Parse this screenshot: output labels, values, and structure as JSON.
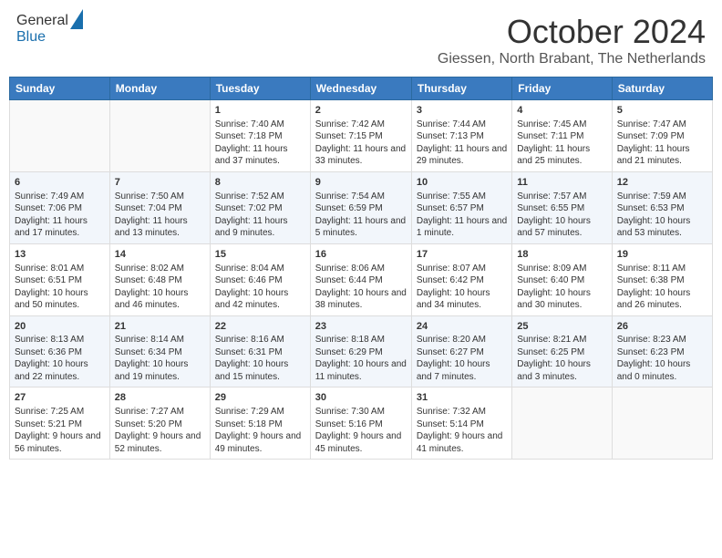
{
  "header": {
    "logo_line1": "General",
    "logo_line2": "Blue",
    "month": "October 2024",
    "location": "Giessen, North Brabant, The Netherlands"
  },
  "weekdays": [
    "Sunday",
    "Monday",
    "Tuesday",
    "Wednesday",
    "Thursday",
    "Friday",
    "Saturday"
  ],
  "weeks": [
    [
      {
        "day": "",
        "info": ""
      },
      {
        "day": "",
        "info": ""
      },
      {
        "day": "1",
        "info": "Sunrise: 7:40 AM\nSunset: 7:18 PM\nDaylight: 11 hours and 37 minutes."
      },
      {
        "day": "2",
        "info": "Sunrise: 7:42 AM\nSunset: 7:15 PM\nDaylight: 11 hours and 33 minutes."
      },
      {
        "day": "3",
        "info": "Sunrise: 7:44 AM\nSunset: 7:13 PM\nDaylight: 11 hours and 29 minutes."
      },
      {
        "day": "4",
        "info": "Sunrise: 7:45 AM\nSunset: 7:11 PM\nDaylight: 11 hours and 25 minutes."
      },
      {
        "day": "5",
        "info": "Sunrise: 7:47 AM\nSunset: 7:09 PM\nDaylight: 11 hours and 21 minutes."
      }
    ],
    [
      {
        "day": "6",
        "info": "Sunrise: 7:49 AM\nSunset: 7:06 PM\nDaylight: 11 hours and 17 minutes."
      },
      {
        "day": "7",
        "info": "Sunrise: 7:50 AM\nSunset: 7:04 PM\nDaylight: 11 hours and 13 minutes."
      },
      {
        "day": "8",
        "info": "Sunrise: 7:52 AM\nSunset: 7:02 PM\nDaylight: 11 hours and 9 minutes."
      },
      {
        "day": "9",
        "info": "Sunrise: 7:54 AM\nSunset: 6:59 PM\nDaylight: 11 hours and 5 minutes."
      },
      {
        "day": "10",
        "info": "Sunrise: 7:55 AM\nSunset: 6:57 PM\nDaylight: 11 hours and 1 minute."
      },
      {
        "day": "11",
        "info": "Sunrise: 7:57 AM\nSunset: 6:55 PM\nDaylight: 10 hours and 57 minutes."
      },
      {
        "day": "12",
        "info": "Sunrise: 7:59 AM\nSunset: 6:53 PM\nDaylight: 10 hours and 53 minutes."
      }
    ],
    [
      {
        "day": "13",
        "info": "Sunrise: 8:01 AM\nSunset: 6:51 PM\nDaylight: 10 hours and 50 minutes."
      },
      {
        "day": "14",
        "info": "Sunrise: 8:02 AM\nSunset: 6:48 PM\nDaylight: 10 hours and 46 minutes."
      },
      {
        "day": "15",
        "info": "Sunrise: 8:04 AM\nSunset: 6:46 PM\nDaylight: 10 hours and 42 minutes."
      },
      {
        "day": "16",
        "info": "Sunrise: 8:06 AM\nSunset: 6:44 PM\nDaylight: 10 hours and 38 minutes."
      },
      {
        "day": "17",
        "info": "Sunrise: 8:07 AM\nSunset: 6:42 PM\nDaylight: 10 hours and 34 minutes."
      },
      {
        "day": "18",
        "info": "Sunrise: 8:09 AM\nSunset: 6:40 PM\nDaylight: 10 hours and 30 minutes."
      },
      {
        "day": "19",
        "info": "Sunrise: 8:11 AM\nSunset: 6:38 PM\nDaylight: 10 hours and 26 minutes."
      }
    ],
    [
      {
        "day": "20",
        "info": "Sunrise: 8:13 AM\nSunset: 6:36 PM\nDaylight: 10 hours and 22 minutes."
      },
      {
        "day": "21",
        "info": "Sunrise: 8:14 AM\nSunset: 6:34 PM\nDaylight: 10 hours and 19 minutes."
      },
      {
        "day": "22",
        "info": "Sunrise: 8:16 AM\nSunset: 6:31 PM\nDaylight: 10 hours and 15 minutes."
      },
      {
        "day": "23",
        "info": "Sunrise: 8:18 AM\nSunset: 6:29 PM\nDaylight: 10 hours and 11 minutes."
      },
      {
        "day": "24",
        "info": "Sunrise: 8:20 AM\nSunset: 6:27 PM\nDaylight: 10 hours and 7 minutes."
      },
      {
        "day": "25",
        "info": "Sunrise: 8:21 AM\nSunset: 6:25 PM\nDaylight: 10 hours and 3 minutes."
      },
      {
        "day": "26",
        "info": "Sunrise: 8:23 AM\nSunset: 6:23 PM\nDaylight: 10 hours and 0 minutes."
      }
    ],
    [
      {
        "day": "27",
        "info": "Sunrise: 7:25 AM\nSunset: 5:21 PM\nDaylight: 9 hours and 56 minutes."
      },
      {
        "day": "28",
        "info": "Sunrise: 7:27 AM\nSunset: 5:20 PM\nDaylight: 9 hours and 52 minutes."
      },
      {
        "day": "29",
        "info": "Sunrise: 7:29 AM\nSunset: 5:18 PM\nDaylight: 9 hours and 49 minutes."
      },
      {
        "day": "30",
        "info": "Sunrise: 7:30 AM\nSunset: 5:16 PM\nDaylight: 9 hours and 45 minutes."
      },
      {
        "day": "31",
        "info": "Sunrise: 7:32 AM\nSunset: 5:14 PM\nDaylight: 9 hours and 41 minutes."
      },
      {
        "day": "",
        "info": ""
      },
      {
        "day": "",
        "info": ""
      }
    ]
  ]
}
